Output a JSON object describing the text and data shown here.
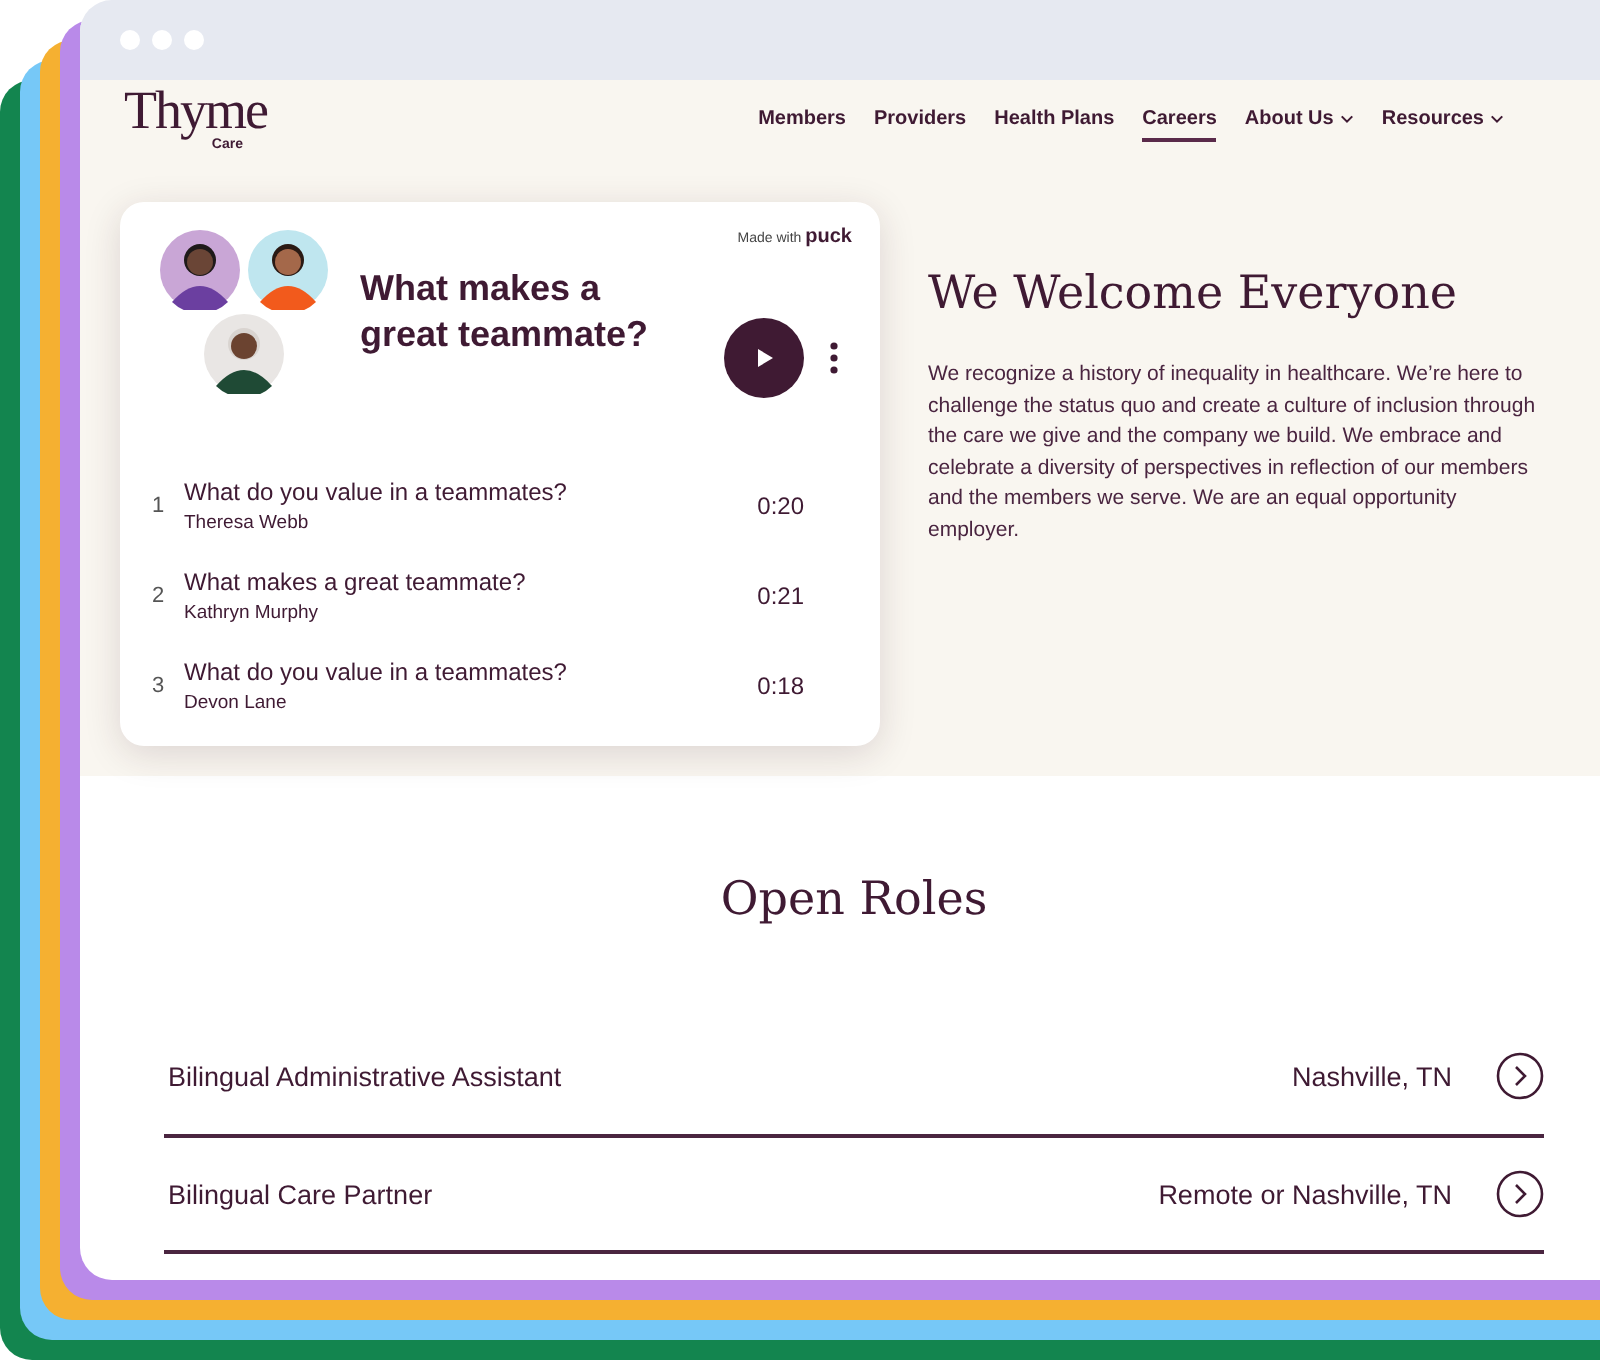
{
  "logo": {
    "name": "Thyme",
    "sub": "Care"
  },
  "nav": [
    {
      "label": "Members",
      "selected": false,
      "dropdown": false
    },
    {
      "label": "Providers",
      "selected": false,
      "dropdown": false
    },
    {
      "label": "Health Plans",
      "selected": false,
      "dropdown": false
    },
    {
      "label": "Careers",
      "selected": true,
      "dropdown": false
    },
    {
      "label": "About Us",
      "selected": false,
      "dropdown": true
    },
    {
      "label": "Resources",
      "selected": false,
      "dropdown": true
    }
  ],
  "card": {
    "badge_prefix": "Made with",
    "badge_brand": "puck",
    "title": "What makes a great teammate?",
    "tracks": [
      {
        "number": "1",
        "title": "What do you value in a teammates?",
        "author": "Theresa Webb",
        "duration": "0:20"
      },
      {
        "number": "2",
        "title": "What makes a great teammate?",
        "author": "Kathryn Murphy",
        "duration": "0:21"
      },
      {
        "number": "3",
        "title": "What do you value in a teammates?",
        "author": "Devon Lane",
        "duration": "0:18"
      }
    ]
  },
  "hero": {
    "heading": "We Welcome Everyone",
    "body": "We recognize a history of inequality in healthcare. We’re here to challenge the status quo and create a culture of inclusion through the care we give and the company we build. We embrace and celebrate a diversity of perspectives in reflection of our members and the members we serve. We are an equal opportunity employer."
  },
  "roles": {
    "heading": "Open Roles",
    "items": [
      {
        "title": "Bilingual Administrative Assistant",
        "location": "Nashville, TN"
      },
      {
        "title": "Bilingual Care Partner",
        "location": "Remote or Nashville, TN"
      }
    ]
  }
}
